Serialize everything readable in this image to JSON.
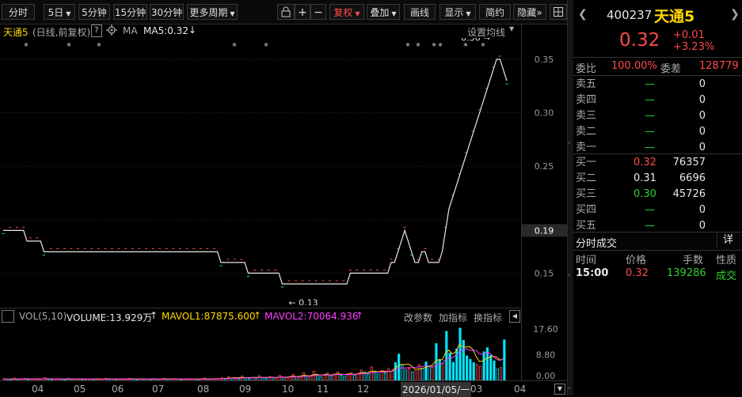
{
  "toolbar": {
    "periods": [
      "分时",
      "5日",
      "5分钟",
      "15分钟",
      "30分钟",
      "更多周期"
    ],
    "right_buttons": [
      "复权",
      "叠加",
      "画线",
      "显示",
      "简约",
      "隐藏"
    ],
    "active_rights": "复权"
  },
  "chart_header": {
    "name": "天通5",
    "mode": "(日线,前复权)",
    "help": "?",
    "indicator": "MA",
    "ma_text": "MA5:0.32",
    "settings": "设置均线"
  },
  "volume_header": {
    "label": "VOL(5,10)",
    "volume": "VOLUME:13.929万",
    "mavol1": "MAVOL1:87875.600",
    "mavol2": "MAVOL2:70064.936",
    "buttons": [
      "改参数",
      "加指标",
      "换指标"
    ]
  },
  "x_axis": {
    "labels": [
      "04",
      "05",
      "06",
      "07",
      "08",
      "09",
      "10",
      "11",
      "12",
      "2026/01/05/一",
      "03",
      "04"
    ]
  },
  "annotations": {
    "high_label": "0.36",
    "low_label": "0.13"
  },
  "chart_data": [
    {
      "type": "line",
      "title": "天通5 (日线,前复权)",
      "y_ticks": [
        0.15,
        0.2,
        0.25,
        0.3,
        0.35
      ],
      "y_tick_labels": [
        "0.35",
        "0.30",
        "0.25",
        "0.19",
        "0.15"
      ],
      "current_price_tag": "0.19",
      "ylim": [
        0.12,
        0.37
      ],
      "high": 0.36,
      "low": 0.13,
      "values": [
        0.19,
        0.19,
        0.19,
        0.19,
        0.19,
        0.19,
        0.19,
        0.18,
        0.18,
        0.18,
        0.18,
        0.18,
        0.17,
        0.17,
        0.17,
        0.17,
        0.17,
        0.17,
        0.17,
        0.17,
        0.17,
        0.17,
        0.17,
        0.17,
        0.17,
        0.17,
        0.17,
        0.17,
        0.17,
        0.17,
        0.17,
        0.17,
        0.17,
        0.17,
        0.17,
        0.17,
        0.17,
        0.17,
        0.17,
        0.17,
        0.17,
        0.17,
        0.17,
        0.17,
        0.17,
        0.17,
        0.17,
        0.17,
        0.17,
        0.17,
        0.17,
        0.17,
        0.17,
        0.17,
        0.17,
        0.17,
        0.17,
        0.17,
        0.17,
        0.17,
        0.17,
        0.17,
        0.17,
        0.17,
        0.16,
        0.16,
        0.16,
        0.16,
        0.16,
        0.16,
        0.16,
        0.16,
        0.15,
        0.15,
        0.15,
        0.15,
        0.15,
        0.15,
        0.15,
        0.15,
        0.15,
        0.15,
        0.14,
        0.14,
        0.14,
        0.14,
        0.14,
        0.14,
        0.14,
        0.14,
        0.14,
        0.14,
        0.14,
        0.14,
        0.14,
        0.14,
        0.14,
        0.14,
        0.14,
        0.14,
        0.14,
        0.14,
        0.15,
        0.15,
        0.15,
        0.15,
        0.15,
        0.15,
        0.15,
        0.15,
        0.15,
        0.15,
        0.15,
        0.15,
        0.16,
        0.16,
        0.17,
        0.18,
        0.19,
        0.18,
        0.17,
        0.16,
        0.16,
        0.17,
        0.17,
        0.16,
        0.16,
        0.16,
        0.16,
        0.17,
        0.19,
        0.21,
        0.22,
        0.23,
        0.24,
        0.25,
        0.26,
        0.27,
        0.28,
        0.29,
        0.3,
        0.31,
        0.32,
        0.33,
        0.34,
        0.35,
        0.35,
        0.34,
        0.33
      ]
    },
    {
      "type": "bar",
      "title": "VOL(5,10)",
      "y_ticks": [
        0,
        8.8,
        17.6
      ],
      "y_tick_labels": [
        "17.60",
        "8.80",
        "0.00"
      ],
      "ylim": [
        0,
        19.5
      ],
      "values": [
        0.6,
        0.4,
        0.3,
        0.8,
        0.5,
        0.4,
        0.7,
        0.3,
        0.5,
        0.4,
        0.6,
        0.5,
        0.9,
        0.4,
        0.3,
        0.5,
        0.6,
        0.4,
        0.3,
        0.7,
        0.5,
        0.4,
        0.6,
        0.3,
        0.5,
        0.4,
        0.3,
        0.6,
        0.5,
        0.4,
        0.7,
        0.5,
        0.4,
        0.3,
        0.6,
        0.5,
        0.4,
        0.7,
        0.5,
        0.3,
        0.6,
        0.4,
        0.5,
        0.3,
        0.6,
        0.4,
        0.5,
        0.7,
        0.5,
        0.4,
        0.6,
        0.5,
        0.3,
        0.4,
        0.6,
        0.5,
        0.4,
        0.3,
        0.6,
        0.8,
        0.5,
        0.4,
        0.6,
        0.5,
        0.9,
        0.7,
        1.2,
        0.8,
        1.0,
        0.6,
        1.5,
        0.9,
        0.7,
        1.1,
        0.8,
        1.6,
        0.9,
        0.7,
        1.3,
        1.0,
        0.8,
        1.7,
        1.1,
        0.9,
        1.4,
        2.1,
        1.2,
        1.0,
        2.6,
        1.5,
        1.3,
        3.1,
        2.0,
        1.2,
        1.8,
        2.5,
        1.6,
        2.2,
        2.9,
        1.8,
        1.4,
        2.3,
        2.7,
        1.9,
        2.4,
        3.5,
        2.8,
        2.1,
        4.6,
        3.0,
        2.2,
        3.4,
        2.6,
        4.0,
        3.2,
        6.1,
        9.0,
        5.2,
        3.6,
        4.1,
        2.9,
        3.3,
        5.4,
        4.2,
        6.3,
        5.0,
        4.7,
        12.6,
        7.1,
        5.8,
        16.8,
        9.4,
        6.2,
        10.8,
        17.9,
        13.7,
        8.4,
        7.2,
        6.1,
        5.5,
        4.9,
        9.8,
        11.2,
        8.6,
        6.7,
        3.9,
        4.4,
        13.9
      ],
      "mavol1_color": "#ffd800",
      "mavol2_color": "#ff3cff"
    }
  ],
  "colors": {
    "up": "#ff4a4a",
    "down": "#2fd12f",
    "highlight": "#00e5ff",
    "price_line": "#e8e8e8",
    "accent_orange": "#ff8c00"
  },
  "quote": {
    "code": "400237",
    "name": "天通5",
    "price": "0.32",
    "change": "+0.01",
    "change_pct": "+3.23%",
    "weibi_label": "委比",
    "weibi_value": "100.00%",
    "weicha_label": "委差",
    "weicha_value": "128779",
    "sell_levels": [
      {
        "label": "卖五",
        "price": "—",
        "volume": "0"
      },
      {
        "label": "卖四",
        "price": "—",
        "volume": "0"
      },
      {
        "label": "卖三",
        "price": "—",
        "volume": "0"
      },
      {
        "label": "卖二",
        "price": "—",
        "volume": "0"
      },
      {
        "label": "卖一",
        "price": "—",
        "volume": "0"
      }
    ],
    "buy_levels": [
      {
        "label": "买一",
        "price": "0.32",
        "volume": "76357"
      },
      {
        "label": "买二",
        "price": "0.31",
        "volume": "6696"
      },
      {
        "label": "买三",
        "price": "0.30",
        "volume": "45726"
      },
      {
        "label": "买四",
        "price": "—",
        "volume": "0"
      },
      {
        "label": "买五",
        "price": "—",
        "volume": "0"
      }
    ],
    "trades_title": "分时成交",
    "trades_detail": "详",
    "trades_headers": [
      "时间",
      "价格",
      "手数",
      "性质"
    ],
    "trades": [
      {
        "time": "15:00",
        "price": "0.32",
        "volume": "139286",
        "nature": "成交"
      }
    ]
  }
}
